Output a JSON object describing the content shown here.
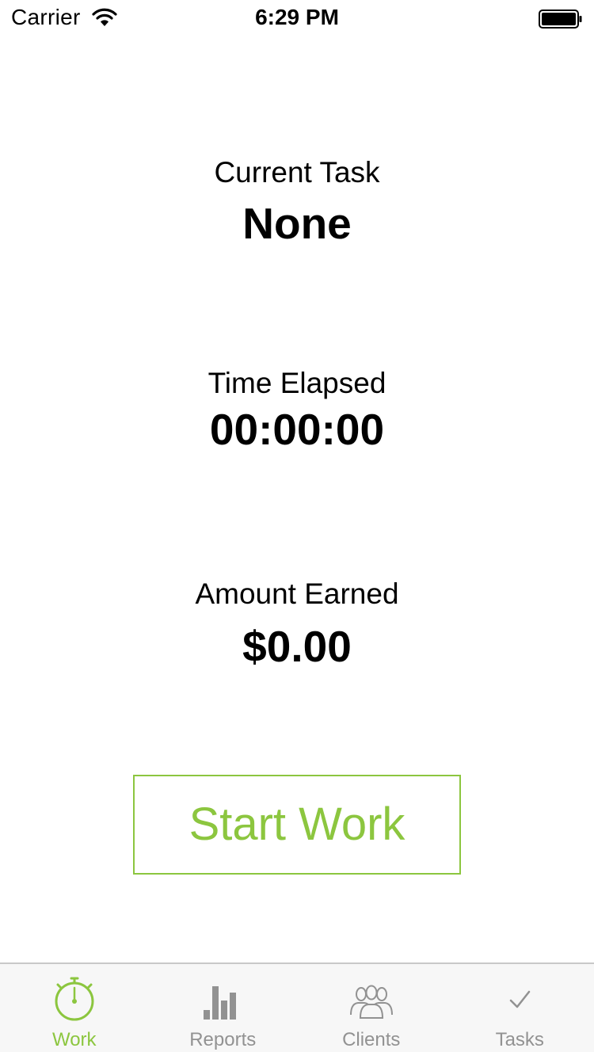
{
  "status_bar": {
    "carrier": "Carrier",
    "time": "6:29 PM"
  },
  "current_task": {
    "label": "Current Task",
    "value": "None"
  },
  "time_elapsed": {
    "label": "Time Elapsed",
    "value": "00:00:00"
  },
  "amount_earned": {
    "label": "Amount Earned",
    "value": "$0.00"
  },
  "start_button": {
    "label": "Start Work"
  },
  "tabs": [
    {
      "label": "Work",
      "icon": "stopwatch-icon",
      "active": true
    },
    {
      "label": "Reports",
      "icon": "bar-chart-icon",
      "active": false
    },
    {
      "label": "Clients",
      "icon": "people-icon",
      "active": false
    },
    {
      "label": "Tasks",
      "icon": "checkmark-icon",
      "active": false
    }
  ],
  "colors": {
    "accent": "#8cc63f",
    "inactive_tab": "#929292",
    "tab_bar_bg": "#f7f7f7"
  }
}
